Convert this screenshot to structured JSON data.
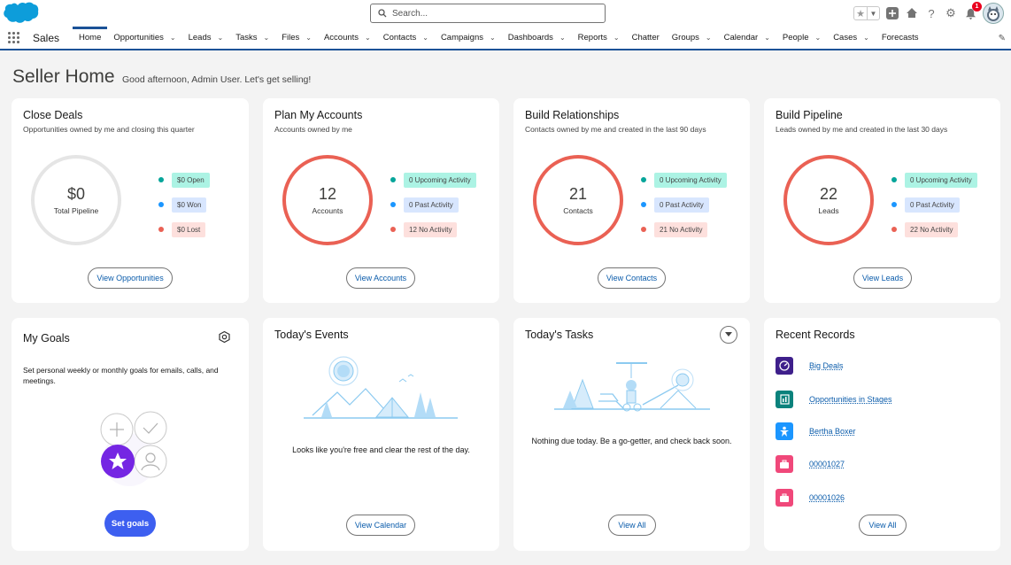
{
  "header": {
    "search_placeholder": "Search...",
    "notification_count": "1"
  },
  "nav": {
    "app_name": "Sales",
    "items": [
      {
        "label": "Home",
        "chevron": false
      },
      {
        "label": "Opportunities",
        "chevron": true
      },
      {
        "label": "Leads",
        "chevron": true
      },
      {
        "label": "Tasks",
        "chevron": true
      },
      {
        "label": "Files",
        "chevron": true
      },
      {
        "label": "Accounts",
        "chevron": true
      },
      {
        "label": "Contacts",
        "chevron": true
      },
      {
        "label": "Campaigns",
        "chevron": true
      },
      {
        "label": "Dashboards",
        "chevron": true
      },
      {
        "label": "Reports",
        "chevron": true
      },
      {
        "label": "Chatter",
        "chevron": false
      },
      {
        "label": "Groups",
        "chevron": true
      },
      {
        "label": "Calendar",
        "chevron": true
      },
      {
        "label": "People",
        "chevron": true
      },
      {
        "label": "Cases",
        "chevron": true
      },
      {
        "label": "Forecasts",
        "chevron": false
      }
    ]
  },
  "page": {
    "title": "Seller Home",
    "greeting": "Good afternoon, Admin User. Let's get selling!"
  },
  "close_deals": {
    "title": "Close Deals",
    "subtitle": "Opportunities owned by me and closing this quarter",
    "value": "$0",
    "label": "Total Pipeline",
    "pills": [
      "$0 Open",
      "$0 Won",
      "$0 Lost"
    ],
    "button": "View Opportunities"
  },
  "plan_accounts": {
    "title": "Plan My Accounts",
    "subtitle": "Accounts owned by me",
    "value": "12",
    "label": "Accounts",
    "pills": [
      "0 Upcoming Activity",
      "0 Past Activity",
      "12 No Activity"
    ],
    "button": "View Accounts"
  },
  "build_relationships": {
    "title": "Build Relationships",
    "subtitle": "Contacts owned by me and created in the last 90 days",
    "value": "21",
    "label": "Contacts",
    "pills": [
      "0 Upcoming Activity",
      "0 Past Activity",
      "21 No Activity"
    ],
    "button": "View Contacts"
  },
  "build_pipeline": {
    "title": "Build Pipeline",
    "subtitle": "Leads owned by me and created in the last 30 days",
    "value": "22",
    "label": "Leads",
    "pills": [
      "0 Upcoming Activity",
      "0 Past Activity",
      "22 No Activity"
    ],
    "button": "View Leads"
  },
  "my_goals": {
    "title": "My Goals",
    "description": "Set personal weekly or monthly goals for emails, calls, and meetings.",
    "button": "Set goals"
  },
  "todays_events": {
    "title": "Today's Events",
    "empty_text": "Looks like you're free and clear the rest of the day.",
    "button": "View Calendar"
  },
  "todays_tasks": {
    "title": "Today's Tasks",
    "empty_text": "Nothing due today. Be a go-getter, and check back soon.",
    "button": "View All"
  },
  "recent_records": {
    "title": "Recent Records",
    "items": [
      {
        "label": "Big Deals",
        "icon": "dashboard-icon"
      },
      {
        "label": "Opportunities in Stages",
        "icon": "report-icon"
      },
      {
        "label": "Bertha Boxer",
        "icon": "lead-icon"
      },
      {
        "label": "00001027",
        "icon": "case-icon"
      },
      {
        "label": "00001026",
        "icon": "case-icon"
      }
    ],
    "button": "View All"
  },
  "colors": {
    "brand": "#0176d3",
    "nav_active": "#1b5297",
    "ring_red": "#ea6154",
    "teal": "#06a59a",
    "blue": "#0b827c",
    "salmon": "#ea6154",
    "goal_purple": "#7526e3",
    "set_goals_btn": "#3d5ff0"
  }
}
